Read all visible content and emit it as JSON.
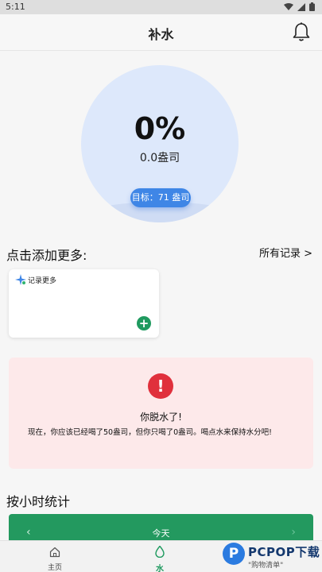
{
  "status_bar": {
    "time": "5:11"
  },
  "header": {
    "title": "补水"
  },
  "progress": {
    "percent_text": "0%",
    "amount_text": "0.0盎司",
    "goal_text": "目标：71 盎司",
    "fill_fraction": 0
  },
  "records": {
    "section_title": "点击添加更多:",
    "all_records_label": "所有记录 >",
    "card_label": "记录更多",
    "add_label": "+"
  },
  "alert": {
    "icon": "!",
    "title": "你脱水了!",
    "message": "现在，你应该已经喝了50盎司，但你只喝了0盎司。喝点水来保持水分吧!"
  },
  "hourly": {
    "section_title": "按小时统计",
    "day_label": "今天"
  },
  "nav": {
    "home_label": "主页",
    "water_label": "水"
  },
  "watermark": {
    "logo_letter": "P",
    "brand": "PCPOP下载",
    "sub": "\"购物清单\""
  },
  "colors": {
    "accent_green": "#23995f",
    "goal_blue": "#3f86e6",
    "circle_blue": "#dde8fb",
    "alert_bg": "#fde9ea",
    "alert_red": "#e0303c"
  }
}
